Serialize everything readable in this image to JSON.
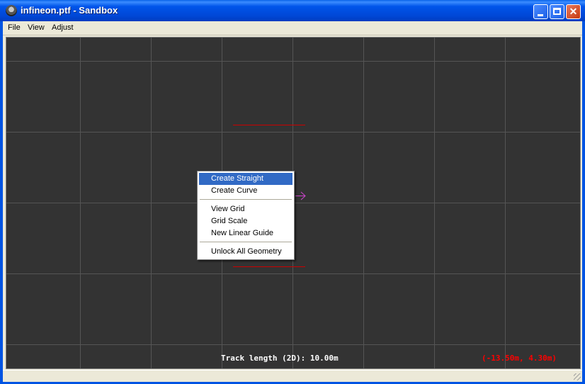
{
  "window": {
    "title": "infineon.ptf - Sandbox"
  },
  "menu": {
    "file": "File",
    "view": "View",
    "adjust": "Adjust"
  },
  "canvas": {
    "track_length_text": "Track length (2D): 10.00m",
    "coords_text": "(-13.50m, 4.30m)"
  },
  "context_menu": {
    "items": [
      "Create Straight",
      "Create Curve",
      "View Grid",
      "Grid Scale",
      "New Linear Guide",
      "Unlock All Geometry"
    ],
    "highlighted": "Create Straight"
  },
  "colors": {
    "canvas_bg": "#333333",
    "grid": "#555555",
    "track": "#cc0000",
    "selection": "#316ac5",
    "coords": "#ff0000",
    "arrow": "#cc44cc"
  }
}
